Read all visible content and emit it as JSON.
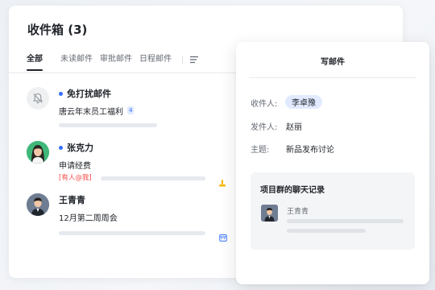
{
  "inbox": {
    "title": "收件箱 (3)",
    "tabs": [
      {
        "label": "全部",
        "active": true
      },
      {
        "label": "未读邮件",
        "active": false
      },
      {
        "label": "审批邮件",
        "active": false
      },
      {
        "label": "日程邮件",
        "active": false
      }
    ],
    "mails": [
      {
        "sender": "免打扰邮件",
        "subject": "唐云年末员工福利",
        "count": "4",
        "unread": true,
        "avatar_icon": "bell-off-icon"
      },
      {
        "sender": "张克力",
        "subject": "申请经费",
        "tag": "[有人@我]",
        "unread": true,
        "avatar_icon": "avatar-woman",
        "side_icon": "hand-icon"
      },
      {
        "sender": "王青青",
        "subject": "12月第二周周会",
        "unread": false,
        "avatar_icon": "avatar-man",
        "side_icon": "calendar-icon"
      }
    ]
  },
  "compose": {
    "title": "写邮件",
    "to_label": "收件人:",
    "to_value": "李卓豫",
    "from_label": "发件人:",
    "from_value": "赵丽",
    "subject_label": "主题:",
    "subject_value": "新品发布讨论",
    "chat": {
      "title": "项目群的聊天记录",
      "name": "王青青"
    }
  },
  "colors": {
    "accent": "#3370ff",
    "mention": "#f54a45",
    "chip_bg": "#e1eaff",
    "badge_warning": "#f5b800"
  }
}
